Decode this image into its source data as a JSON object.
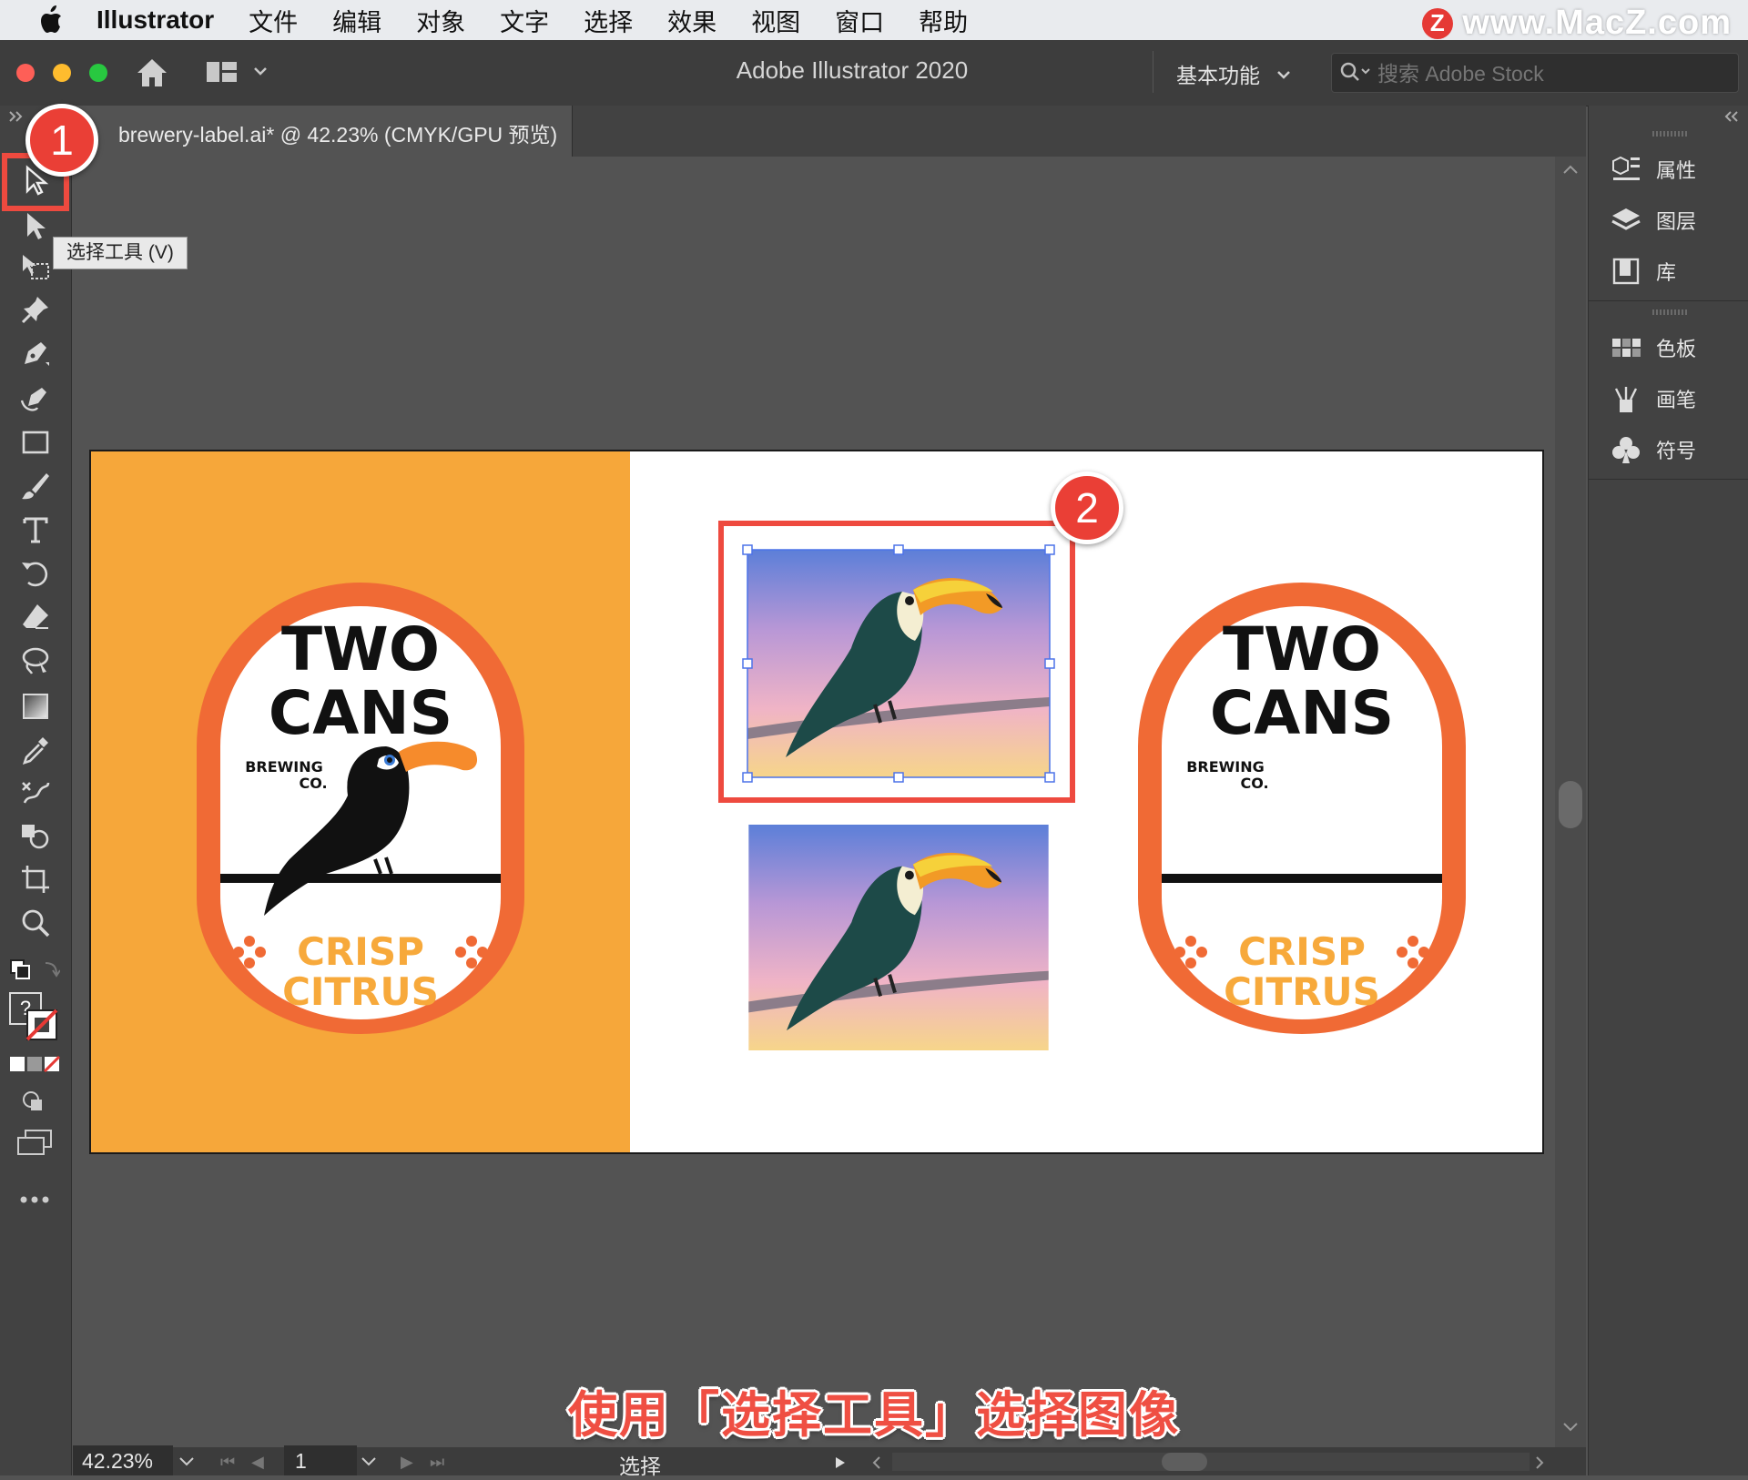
{
  "menubar": {
    "app_name": "Illustrator",
    "menus": [
      "文件",
      "编辑",
      "对象",
      "文字",
      "选择",
      "效果",
      "视图",
      "窗口",
      "帮助"
    ],
    "watermark": "www.MacZ.com",
    "watermark_badge": "Z"
  },
  "appbar": {
    "title": "Adobe Illustrator 2020",
    "workspace": "基本功能",
    "search_placeholder": "搜索 Adobe Stock"
  },
  "document": {
    "tab_title": "brewery-label.ai* @ 42.23% (CMYK/GPU 预览)"
  },
  "toolbar": {
    "tooltip": "选择工具 (V)",
    "fill_stroke_unknown": "?",
    "tools": [
      "selection-tool",
      "direct-selection-tool",
      "artboard-tool",
      "pin-tool",
      "pen-tool",
      "curvature-tool",
      "rectangle-tool",
      "paintbrush-tool",
      "type-tool",
      "rotate-tool",
      "eraser-tool",
      "lasso-tool",
      "gradient-tool",
      "eyedropper-tool",
      "blend-tool",
      "shape-builder-tool",
      "crop-tool",
      "zoom-tool"
    ]
  },
  "callouts": {
    "step1": "1",
    "step2": "2",
    "caption": "使用「选择工具」选择图像"
  },
  "panels": {
    "group1": [
      {
        "label": "属性",
        "icon": "properties-icon"
      },
      {
        "label": "图层",
        "icon": "layers-icon"
      },
      {
        "label": "库",
        "icon": "libraries-icon"
      }
    ],
    "group2": [
      {
        "label": "色板",
        "icon": "swatches-icon"
      },
      {
        "label": "画笔",
        "icon": "brushes-icon"
      },
      {
        "label": "符号",
        "icon": "symbols-icon"
      }
    ]
  },
  "labels": {
    "left": {
      "line1": "TWO",
      "line2": "CANS",
      "sub1": "BREWING",
      "sub2": "CO.",
      "bottom1": "CRISP",
      "bottom2": "CITRUS"
    },
    "right": {
      "line1": "TWO",
      "line2": "CANS",
      "sub1": "BREWING",
      "sub2": "CO.",
      "bottom1": "CRISP",
      "bottom2": "CITRUS"
    }
  },
  "statusbar": {
    "zoom": "42.23%",
    "page": "1",
    "mode": "选择"
  },
  "colors": {
    "accent_red": "#ee4a3f",
    "label_orange": "#f06a35",
    "artboard_orange": "#f6a73a",
    "crisp_citrus": "#f7a93b"
  }
}
